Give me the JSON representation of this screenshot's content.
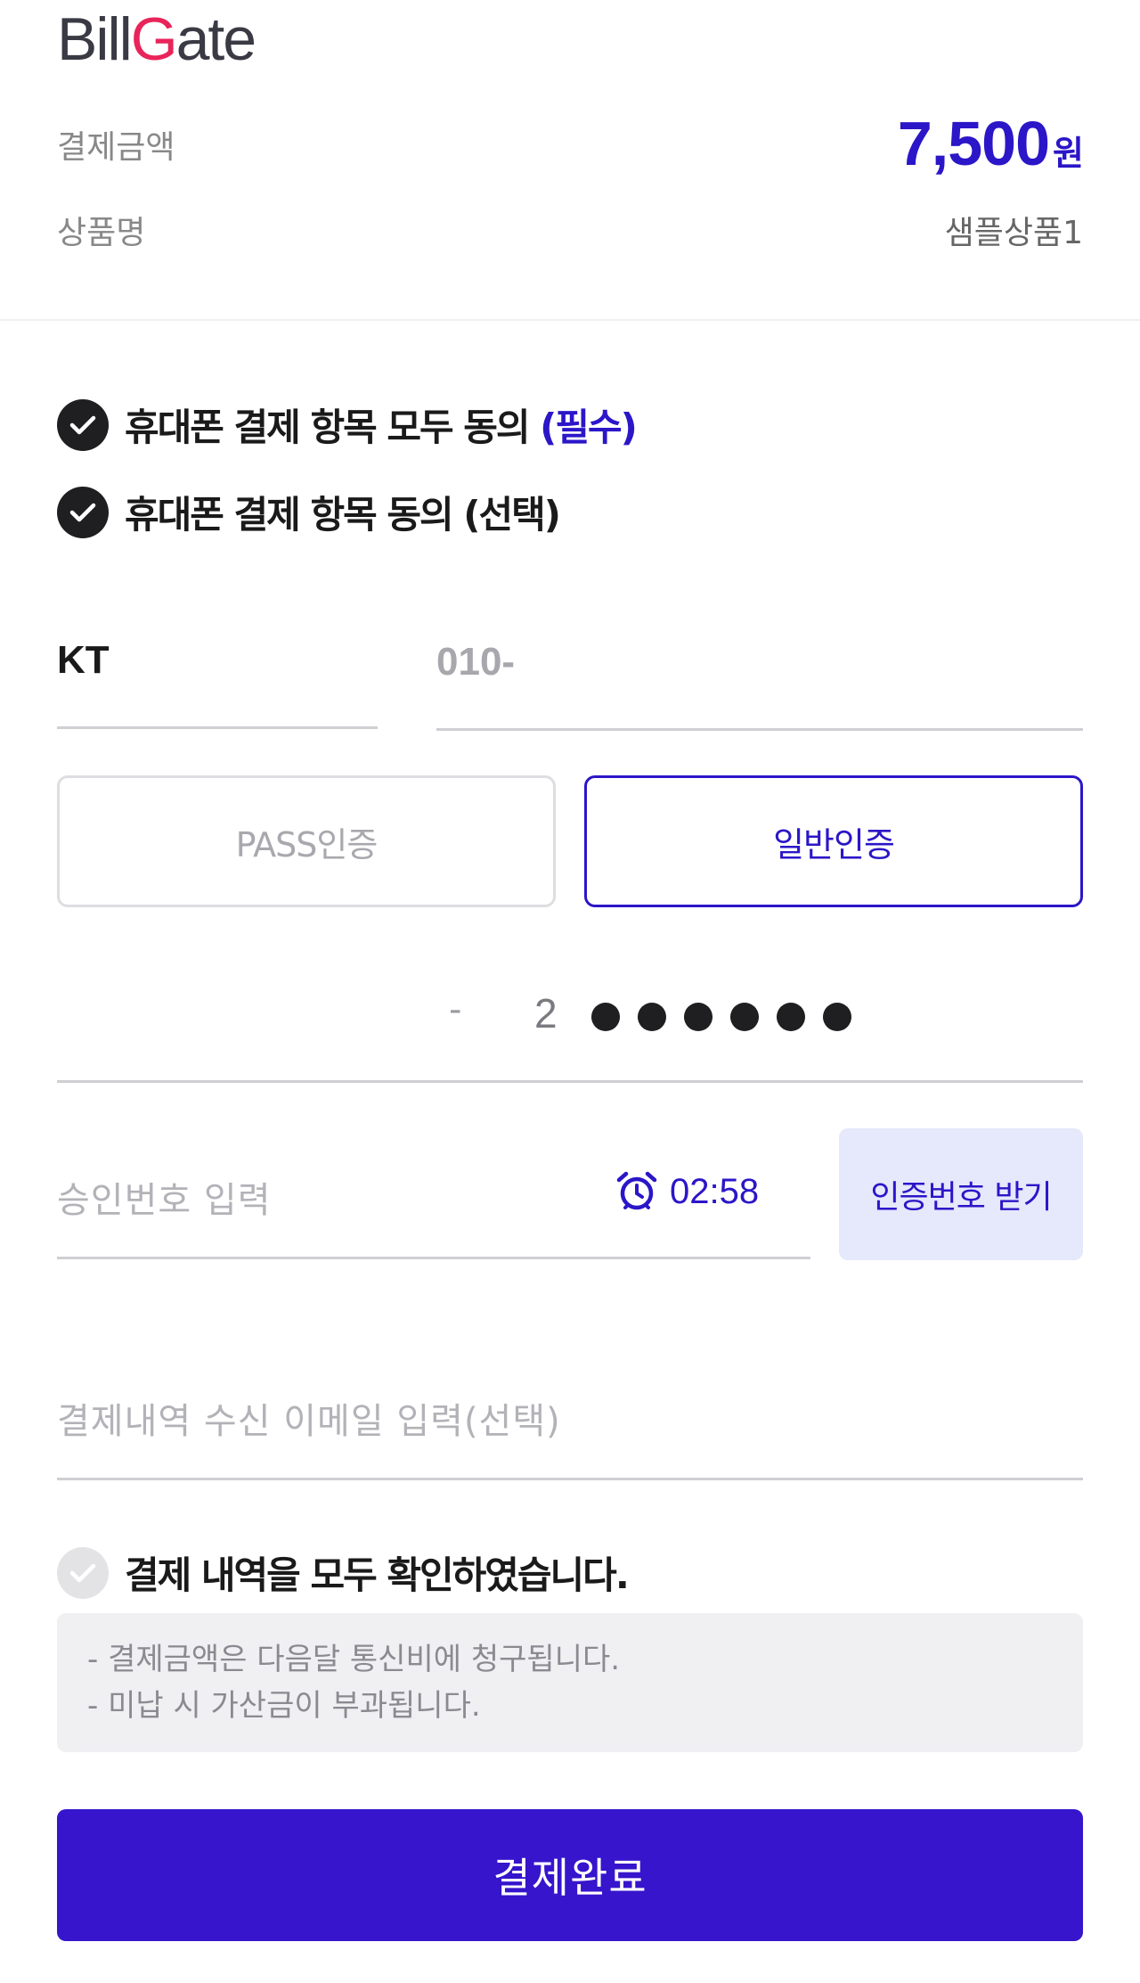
{
  "header": {
    "logo_prefix": "Bill",
    "logo_g": "G",
    "logo_suffix": "ate"
  },
  "summary": {
    "amount_label": "결제금액",
    "amount_value": "7,500",
    "amount_unit": "원",
    "product_label": "상품명",
    "product_value": "샘플상품1"
  },
  "agreements": {
    "all_required_prefix": "휴대폰 결제 항목 모두 동의 ",
    "all_required_suffix": "(필수)",
    "optional": "휴대폰 결제 항목 동의 (선택)"
  },
  "phone": {
    "carrier": "KT",
    "number_value": "010-"
  },
  "auth": {
    "pass_label": "PASS인증",
    "normal_label": "일반인증",
    "selected": "일반인증"
  },
  "id": {
    "dash": "-",
    "first_digit": "2",
    "masked_count": 6
  },
  "approval": {
    "placeholder": "승인번호 입력",
    "timer": "02:58",
    "request_button": "인증번호 받기"
  },
  "email": {
    "placeholder": "결제내역 수신 이메일 입력(선택)"
  },
  "confirm": {
    "label": "결제 내역을 모두 확인하였습니다."
  },
  "notice": {
    "line1": "- 결제금액은 다음달 통신비에 청구됩니다.",
    "line2": "- 미납 시 가산금이 부과됩니다."
  },
  "submit": {
    "label": "결제완료"
  },
  "colors": {
    "accent": "#2b16c8",
    "submit_bg": "#3615cc",
    "logo_g": "#e8245a"
  },
  "icons": {
    "check": "check-icon",
    "alarm": "alarm-clock-icon"
  }
}
